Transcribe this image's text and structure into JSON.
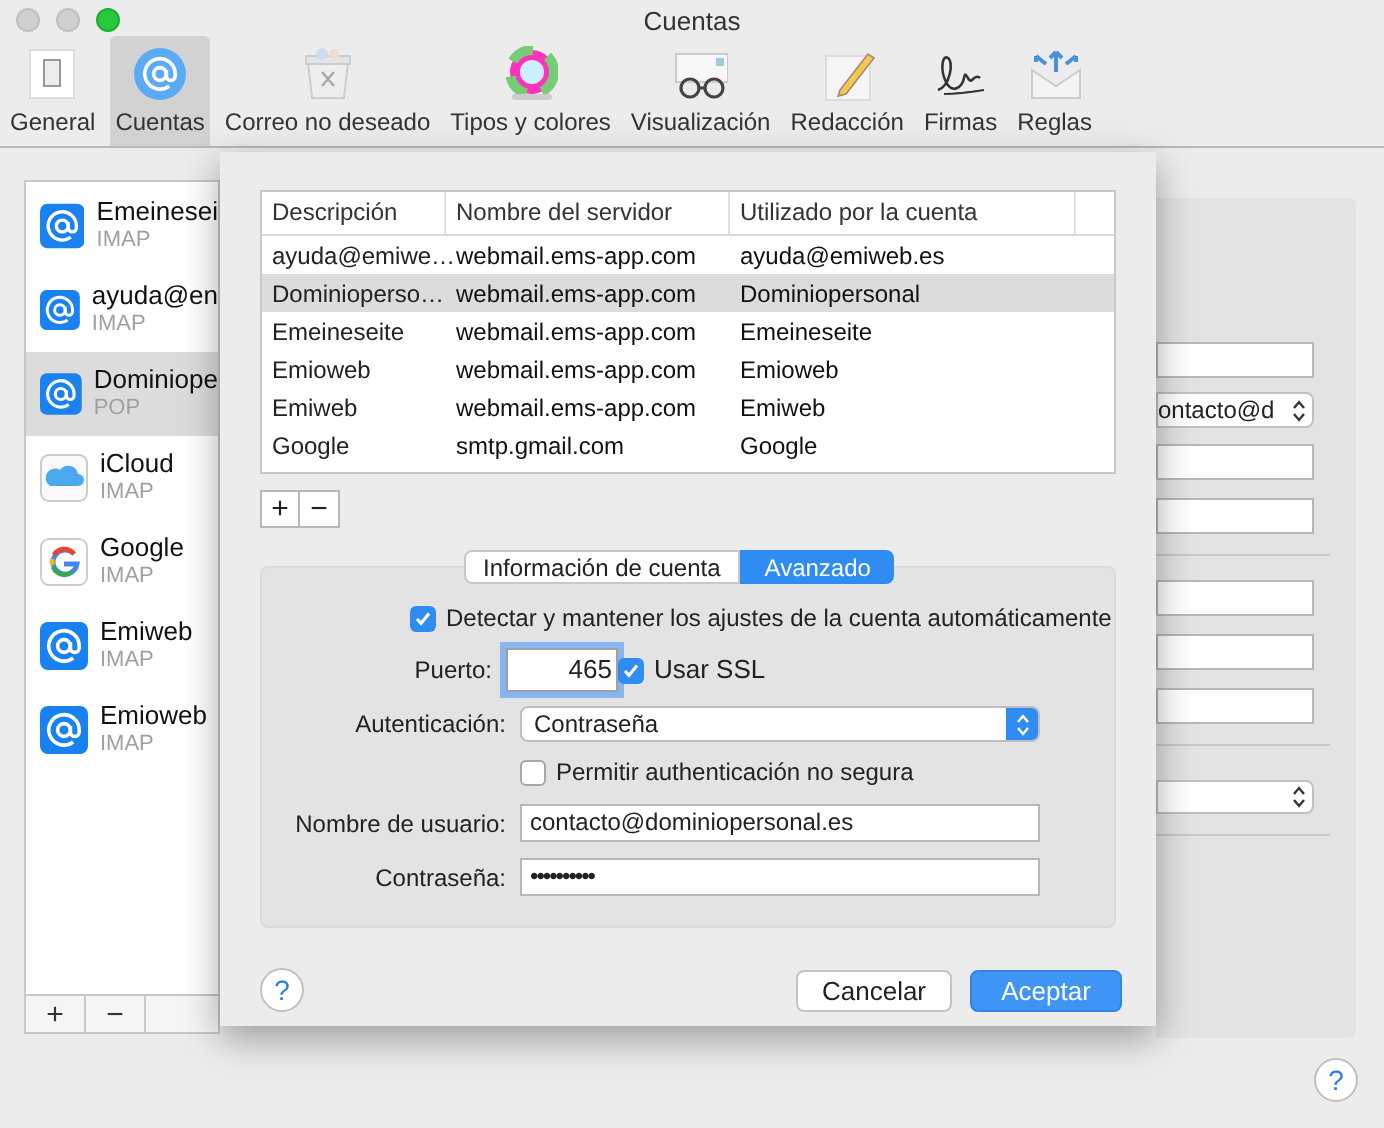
{
  "window": {
    "title": "Cuentas"
  },
  "toolbar": [
    {
      "label": "General",
      "kind": "general",
      "selected": false
    },
    {
      "label": "Cuentas",
      "kind": "accounts",
      "selected": true
    },
    {
      "label": "Correo no deseado",
      "kind": "junk",
      "selected": false
    },
    {
      "label": "Tipos y colores",
      "kind": "fonts",
      "selected": false
    },
    {
      "label": "Visualización",
      "kind": "viewing",
      "selected": false
    },
    {
      "label": "Redacción",
      "kind": "composing",
      "selected": false
    },
    {
      "label": "Firmas",
      "kind": "signatures",
      "selected": false
    },
    {
      "label": "Reglas",
      "kind": "rules",
      "selected": false
    }
  ],
  "accounts": [
    {
      "name": "Emeinesei",
      "type": "IMAP",
      "kind": "mail",
      "selected": false
    },
    {
      "name": "ayuda@en",
      "type": "IMAP",
      "kind": "mail",
      "selected": false
    },
    {
      "name": "Dominiope",
      "type": "POP",
      "kind": "mail",
      "selected": true
    },
    {
      "name": "iCloud",
      "type": "IMAP",
      "kind": "cloud",
      "selected": false
    },
    {
      "name": "Google",
      "type": "IMAP",
      "kind": "google",
      "selected": false
    },
    {
      "name": "Emiweb",
      "type": "IMAP",
      "kind": "mail",
      "selected": false
    },
    {
      "name": "Emioweb",
      "type": "IMAP",
      "kind": "mail",
      "selected": false
    }
  ],
  "account_buttons": [
    "+",
    "−"
  ],
  "account_panel": {
    "email_value": "ontacto@d"
  },
  "help": "?",
  "sheet": {
    "table": {
      "columns": [
        "Descripción",
        "Nombre del servidor",
        "Utilizado por la cuenta"
      ],
      "rows": [
        {
          "cells": [
            "ayuda@emiwe…",
            "webmail.ems-app.com",
            "ayuda@emiweb.es"
          ],
          "selected": false
        },
        {
          "cells": [
            "Dominioperso…",
            "webmail.ems-app.com",
            "Dominiopersonal"
          ],
          "selected": true
        },
        {
          "cells": [
            "Emeineseite",
            "webmail.ems-app.com",
            "Emeineseite"
          ],
          "selected": false
        },
        {
          "cells": [
            "Emioweb",
            "webmail.ems-app.com",
            "Emioweb"
          ],
          "selected": false
        },
        {
          "cells": [
            "Emiweb",
            "webmail.ems-app.com",
            "Emiweb"
          ],
          "selected": false
        },
        {
          "cells": [
            "Google",
            "smtp.gmail.com",
            "Google"
          ],
          "selected": false
        }
      ]
    },
    "table_buttons": [
      "+",
      "−"
    ],
    "tabs": [
      {
        "label": "Información de cuenta",
        "selected": false
      },
      {
        "label": "Avanzado",
        "selected": true
      }
    ],
    "auto_detect": {
      "label": "Detectar y mantener los ajustes de la cuenta automáticamente",
      "checked": true
    },
    "port": {
      "label": "Puerto:",
      "value": "465"
    },
    "ssl": {
      "label": "Usar SSL",
      "checked": true
    },
    "authentication": {
      "label": "Autenticación:",
      "value": "Contraseña"
    },
    "insecure_auth": {
      "label": "Permitir authenticación no segura",
      "checked": false
    },
    "username": {
      "label": "Nombre de usuario:",
      "value": "contacto@dominiopersonal.es"
    },
    "password": {
      "label": "Contraseña:",
      "value": "••••••••••"
    },
    "help": "?",
    "buttons": [
      {
        "label": "Cancelar",
        "kind": "secondary"
      },
      {
        "label": "Aceptar",
        "kind": "primary"
      }
    ]
  }
}
